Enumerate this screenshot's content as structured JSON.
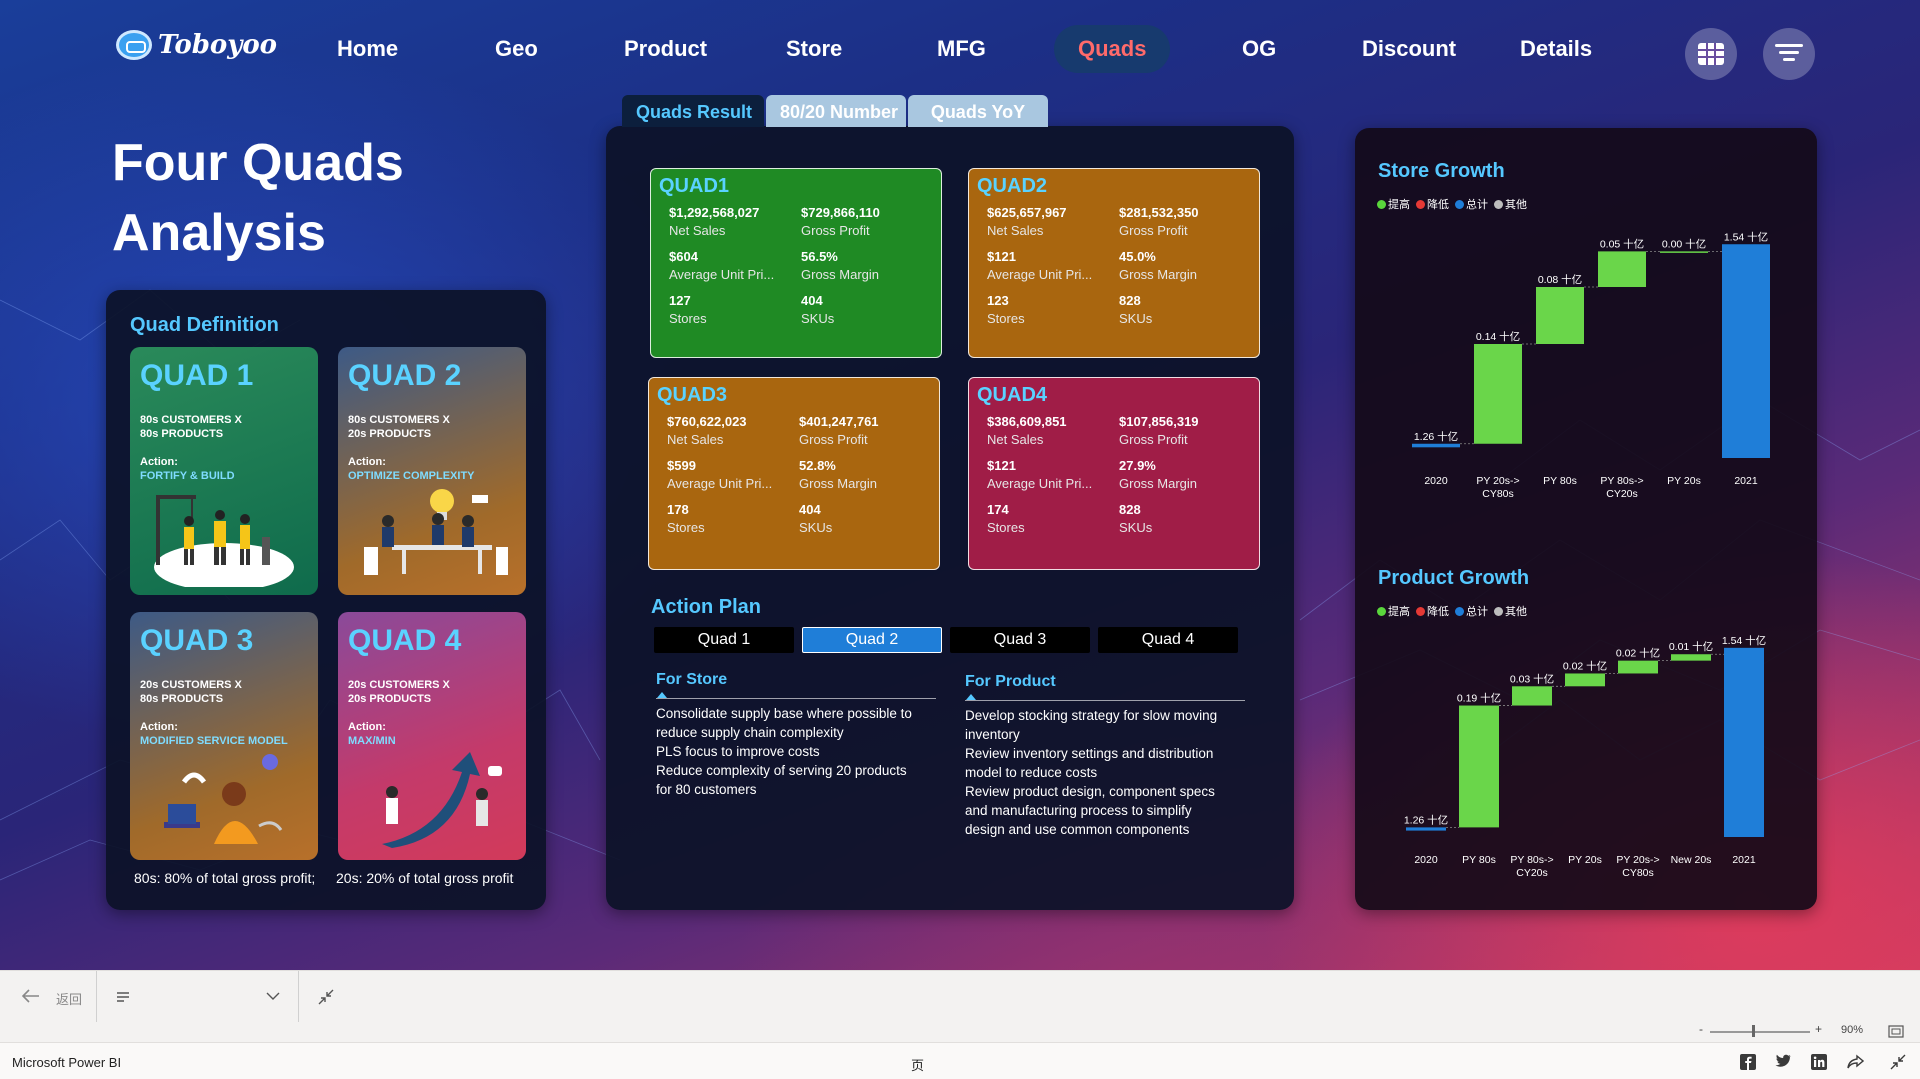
{
  "brand": {
    "name": "Toboyoo"
  },
  "nav": {
    "items": [
      "Home",
      "Geo",
      "Product",
      "Store",
      "MFG",
      "Quads",
      "OG",
      "Discount",
      "Details"
    ],
    "active": "Quads"
  },
  "icons": {
    "table_view": "grid-icon",
    "filter": "filter-icon"
  },
  "page": {
    "title_line1": "Four Quads",
    "title_line2": "Analysis"
  },
  "quad_definition": {
    "title": "Quad Definition",
    "cards": [
      {
        "name": "QUAD 1",
        "segment_line1": "80s CUSTOMERS X",
        "segment_line2": "80s PRODUCTS",
        "action_label": "Action:",
        "action": "FORTIFY & BUILD",
        "illustration": "construction-team-icon"
      },
      {
        "name": "QUAD 2",
        "segment_line1": "80s CUSTOMERS X",
        "segment_line2": "20s PRODUCTS",
        "action_label": "Action:",
        "action": "OPTIMIZE COMPLEXITY",
        "illustration": "meeting-lightbulb-icon"
      },
      {
        "name": "QUAD 3",
        "segment_line1": "20s CUSTOMERS X",
        "segment_line2": "80s PRODUCTS",
        "action_label": "Action:",
        "action": "MODIFIED SERVICE MODEL",
        "illustration": "customer-service-icon"
      },
      {
        "name": "QUAD 4",
        "segment_line1": "20s CUSTOMERS X",
        "segment_line2": "20s PRODUCTS",
        "action_label": "Action:",
        "action": "MAX/MIN",
        "illustration": "growth-arrow-icon"
      }
    ],
    "footnote_80": "80s: 80% of total gross  profit;",
    "footnote_20": "20s: 20% of total gross profit"
  },
  "tabs": [
    "Quads Result",
    "80/20 Number",
    "Quads YoY"
  ],
  "active_tab": "Quads Result",
  "quads": [
    {
      "name": "QUAD1",
      "color": "#1f8a24",
      "net_sales": "$1,292,568,027",
      "net_sales_label": "Net Sales",
      "gross_profit": "$729,866,110",
      "gross_profit_label": "Gross Profit",
      "aup": "$604",
      "aup_label": "Average Unit Pri...",
      "gross_margin": "56.5%",
      "gross_margin_label": "Gross Margin",
      "stores": "127",
      "stores_label": "Stores",
      "skus": "404",
      "skus_label": "SKUs"
    },
    {
      "name": "QUAD2",
      "color": "#a9660f",
      "net_sales": "$625,657,967",
      "net_sales_label": "Net Sales",
      "gross_profit": "$281,532,350",
      "gross_profit_label": "Gross Profit",
      "aup": "$121",
      "aup_label": "Average Unit Pri...",
      "gross_margin": "45.0%",
      "gross_margin_label": "Gross Margin",
      "stores": "123",
      "stores_label": "Stores",
      "skus": "828",
      "skus_label": "SKUs"
    },
    {
      "name": "QUAD3",
      "color": "#a9660f",
      "net_sales": "$760,622,023",
      "net_sales_label": "Net Sales",
      "gross_profit": "$401,247,761",
      "gross_profit_label": "Gross Profit",
      "aup": "$599",
      "aup_label": "Average Unit Pri...",
      "gross_margin": "52.8%",
      "gross_margin_label": "Gross Margin",
      "stores": "178",
      "stores_label": "Stores",
      "skus": "404",
      "skus_label": "SKUs"
    },
    {
      "name": "QUAD4",
      "color": "#a01d47",
      "net_sales": "$386,609,851",
      "net_sales_label": "Net Sales",
      "gross_profit": "$107,856,319",
      "gross_profit_label": "Gross Profit",
      "aup": "$121",
      "aup_label": "Average Unit Pri...",
      "gross_margin": "27.9%",
      "gross_margin_label": "Gross Margin",
      "stores": "174",
      "stores_label": "Stores",
      "skus": "828",
      "skus_label": "SKUs"
    }
  ],
  "action_plan": {
    "title": "Action Plan",
    "buttons": [
      "Quad 1",
      "Quad 2",
      "Quad 3",
      "Quad 4"
    ],
    "active_button": "Quad 2",
    "for_store": {
      "title": "For Store",
      "lines": [
        "Consolidate supply base where possible to",
        "reduce supply chain complexity",
        "PLS focus to improve costs",
        "Reduce complexity of serving 20 products",
        "for 80 customers"
      ]
    },
    "for_product": {
      "title": "For Product",
      "lines": [
        "Develop stocking strategy for slow moving",
        "inventory",
        "Review inventory settings and distribution",
        "model to reduce costs",
        "Review product design, component specs",
        "and manufacturing process to simplify",
        "design and use common components"
      ]
    }
  },
  "legend": [
    {
      "label": "提高",
      "color": "#5ad63c"
    },
    {
      "label": "降低",
      "color": "#e53935"
    },
    {
      "label": "总计",
      "color": "#1f7ed8"
    },
    {
      "label": "其他",
      "color": "#bdbdbd"
    }
  ],
  "chart_data": [
    {
      "type": "waterfall",
      "title": "Store Growth",
      "unit": "十亿",
      "categories": [
        "2020",
        "PY 20s->\nCY80s",
        "PY 80s",
        "PY 80s->\nCY20s",
        "PY 20s",
        "2021"
      ],
      "values": [
        1.26,
        0.14,
        0.08,
        0.05,
        0.0,
        1.54
      ],
      "labels": [
        "1.26 十亿",
        "0.14 十亿",
        "0.08 十亿",
        "0.05 十亿",
        "0.00 十亿",
        "1.54 十亿"
      ],
      "kinds": [
        "total",
        "increase",
        "increase",
        "increase",
        "increase",
        "total"
      ],
      "ylim": [
        1.24,
        1.56
      ]
    },
    {
      "type": "waterfall",
      "title": "Product Growth",
      "unit": "十亿",
      "categories": [
        "2020",
        "PY 80s",
        "PY 80s->\nCY20s",
        "PY 20s",
        "PY 20s->\nCY80s",
        "New 20s",
        "2021"
      ],
      "values": [
        1.26,
        0.19,
        0.03,
        0.02,
        0.02,
        0.01,
        1.54
      ],
      "labels": [
        "1.26 十亿",
        "0.19 十亿",
        "0.03 十亿",
        "0.02 十亿",
        "0.02 十亿",
        "0.01 十亿",
        "1.54 十亿"
      ],
      "kinds": [
        "total",
        "increase",
        "increase",
        "increase",
        "increase",
        "increase",
        "total"
      ],
      "ylim": [
        1.245,
        1.56
      ]
    }
  ],
  "bottom_bar": {
    "back_label": "返回",
    "zoom": "90%",
    "zoom_minus": "-",
    "zoom_plus": "+",
    "app_name": "Microsoft Power BI",
    "page_label": "页"
  }
}
